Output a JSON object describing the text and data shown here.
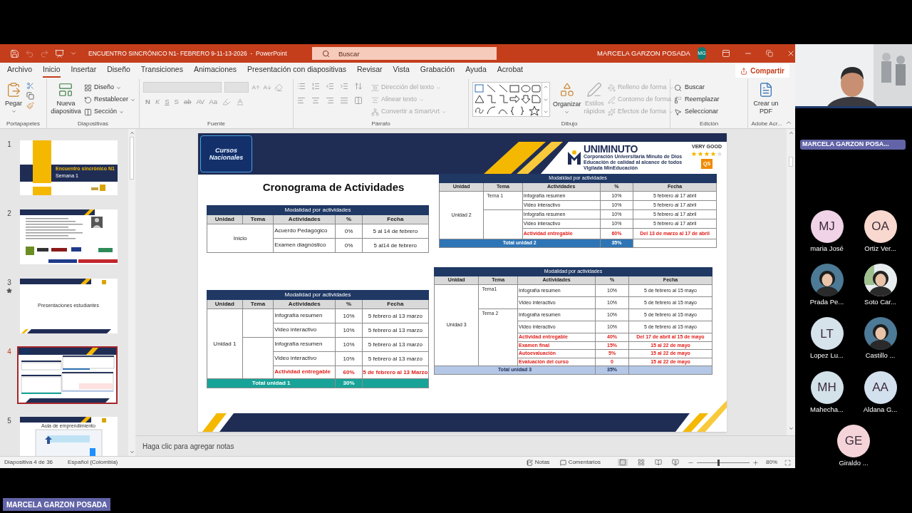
{
  "title_bar": {
    "title": "ENCUENTRO SINCRÓNICO N1- FEBRERO 9-11-13-2026  -  PowerPoint",
    "search": {
      "placeholder": "Buscar"
    },
    "user": "MARCELA GARZON POSADA",
    "avatar": "MG"
  },
  "tabs": [
    {
      "label": "Archivo",
      "selected": false
    },
    {
      "label": "Inicio",
      "selected": true
    },
    {
      "label": "Insertar",
      "selected": false
    },
    {
      "label": "Diseño",
      "selected": false
    },
    {
      "label": "Transiciones",
      "selected": false
    },
    {
      "label": "Animaciones",
      "selected": false
    },
    {
      "label": "Presentación con diapositivas",
      "selected": false
    },
    {
      "label": "Revisar",
      "selected": false
    },
    {
      "label": "Vista",
      "selected": false
    },
    {
      "label": "Grabación",
      "selected": false
    },
    {
      "label": "Ayuda",
      "selected": false
    },
    {
      "label": "Acrobat",
      "selected": false
    }
  ],
  "share_button": "Compartir",
  "ribbon": {
    "clipboard": {
      "label": "Portapapeles",
      "paste": "Pegar"
    },
    "slides": {
      "label": "Diapositivas",
      "new_slide": "Nueva diapositiva",
      "commands": [
        "Diseño",
        "Restablecer",
        "Sección"
      ]
    },
    "font": {
      "label": "Fuente",
      "disabled": true,
      "format_buttons": [
        "N",
        "K",
        "S",
        "S",
        "ab",
        "AV",
        "Aa"
      ]
    },
    "paragraph": {
      "label": "Párrafo",
      "commands": [
        {
          "label": "Dirección del texto",
          "disabled": true
        },
        {
          "label": "Alinear texto",
          "disabled": true
        },
        {
          "label": "Convertir a SmartArt",
          "disabled": true
        }
      ]
    },
    "drawing": {
      "label": "Dibujo",
      "arrange": "Organizar",
      "quick_styles": {
        "label": "Estilos rápidos",
        "disabled": true
      },
      "commands": [
        {
          "label": "Relleno de forma",
          "disabled": true
        },
        {
          "label": "Contorno de forma",
          "disabled": true
        },
        {
          "label": "Efectos de forma",
          "disabled": true
        }
      ]
    },
    "editing": {
      "label": "Edición",
      "commands": [
        "Buscar",
        "Reemplazar",
        "Seleccionar"
      ]
    },
    "adobe": {
      "label": "Adobe Acr...",
      "create_pdf": "Crear un PDF"
    }
  },
  "thumbnails": [
    {
      "number": "1",
      "kind": "title",
      "selected": false,
      "starred": false,
      "texts": [
        "Encuentro sincrónico N1",
        "Semana 1"
      ]
    },
    {
      "number": "2",
      "kind": "content",
      "selected": false,
      "starred": false
    },
    {
      "number": "3",
      "kind": "section",
      "selected": false,
      "starred": true,
      "texts": [
        "Presentaciones estudiantes"
      ]
    },
    {
      "number": "4",
      "kind": "tables",
      "selected": true,
      "starred": false
    },
    {
      "number": "5",
      "kind": "screenshot",
      "selected": false,
      "starred": false,
      "texts": [
        "Aula de emprendimiento"
      ]
    }
  ],
  "slide": {
    "title": "Cronograma de Actividades",
    "logo_left": "Cursos Nacionales",
    "logo_right": {
      "name": "UNIMINUTO",
      "lines": [
        "Corporación Universitaria Minuto de Dios",
        "Educación de calidad al alcance de todos",
        "Vigilada MinEducación"
      ],
      "rating": "VERY GOOD",
      "stars": 4,
      "badge": "QS"
    },
    "tables": [
      {
        "header": "Modalidad por actividades",
        "columns": [
          "Unidad",
          "Tema",
          "Actividades",
          "%",
          "Fecha"
        ],
        "unit": "Inicio",
        "rows": [
          {
            "activity": "Acuerdo Pedagógico",
            "percent": "0%",
            "date": "5 al 14 de febrero",
            "emphasis": false
          },
          {
            "activity": "Examen diagnóstico",
            "percent": "0%",
            "date": "5 al14 de febrero",
            "emphasis": false
          }
        ]
      },
      {
        "header": "Modalidad por actividades",
        "columns": [
          "Unidad",
          "Tema",
          "Actividades",
          "%",
          "Fecha"
        ],
        "unit": "Unidad 2",
        "temas": [
          {
            "label": "Tema 1",
            "rows": [
              {
                "activity": "Infografía resumen",
                "percent": "10%",
                "date": "5 febrero al 17 abril",
                "emphasis": false
              },
              {
                "activity": "Video interactivo",
                "percent": "10%",
                "date": "5 febrero al 17 abril",
                "emphasis": false
              }
            ]
          },
          {
            "rows": [
              {
                "activity": "Infografía resumen",
                "percent": "10%",
                "date": "5 febrero al 17 abril",
                "emphasis": false
              },
              {
                "activity": "Video interactivo",
                "percent": "10%",
                "date": "5 febrero al 17 abril",
                "emphasis": false
              },
              {
                "activity": "Actividad entregable",
                "percent": "60%",
                "date": "Del 13 de marzo al 17 de abril",
                "emphasis": true
              }
            ]
          }
        ],
        "total": {
          "label": "Total unidad 2",
          "percent": "35%",
          "color": "#2e75b6",
          "spans_date": false
        }
      },
      {
        "header": "Modalidad por actividades",
        "columns": [
          "Unidad",
          "Tema",
          "Actividades",
          "%",
          "Fecha"
        ],
        "unit": "Unidad 1",
        "temas": [
          {
            "rows": [
              {
                "activity": "Infografía resumen",
                "percent": "10%",
                "date": "5 febrero al 13 marzo",
                "emphasis": false
              },
              {
                "activity": "Video interactivo",
                "percent": "10%",
                "date": "5 febrero al 13 marzo",
                "emphasis": false
              }
            ]
          },
          {
            "rows": [
              {
                "activity": "Infografía resumen",
                "percent": "10%",
                "date": "5 febrero al 13 marzo",
                "emphasis": false
              },
              {
                "activity": "Video interactivo",
                "percent": "10%",
                "date": "5 febrero al 13 marzo",
                "emphasis": false
              },
              {
                "activity": "Actividad entregable",
                "percent": "60%",
                "date": "5 de febrero al 13 Marzo",
                "emphasis": true
              }
            ]
          }
        ],
        "total": {
          "label": "Total unidad 1",
          "percent": "30%",
          "color": "#17a398",
          "spans_date": true
        }
      },
      {
        "header": "Modalidad por actividades",
        "columns": [
          "Unidad",
          "Tema",
          "Actividades",
          "%",
          "Fecha"
        ],
        "unit": "Unidad 3",
        "temas": [
          {
            "label": "Tema1",
            "rows": [
              {
                "activity": "Infografía resumen",
                "percent": "10%",
                "date": "5 de febrero al 15 mayo",
                "emphasis": false
              },
              {
                "activity": "Video interactivo",
                "percent": "10%",
                "date": "5 de febrero al 15 mayo",
                "emphasis": false
              }
            ]
          },
          {
            "label": "Tema 2",
            "rows": [
              {
                "activity": "Infografía resumen",
                "percent": "10%",
                "date": "5 de febrero al 15 mayo",
                "emphasis": false
              },
              {
                "activity": "Video interactivo",
                "percent": "10%",
                "date": "5 de febrero al 15 mayo",
                "emphasis": false
              },
              {
                "activity": "Actividad entregable",
                "percent": "40%",
                "date": "Del 17 de abril al 15 de mayo",
                "emphasis": true
              },
              {
                "activity": "Examen final",
                "percent": "15%",
                "date": "15 al 22 de mayo",
                "emphasis": true
              },
              {
                "activity": "Autoevaluación",
                "percent": "5%",
                "date": "15 al 22 de mayo",
                "emphasis": true
              },
              {
                "activity": "Evaluación del curso",
                "percent": "0",
                "date": "15 al 22 de mayo",
                "emphasis": true
              }
            ]
          }
        ],
        "total": {
          "label": "Total unidad 3",
          "percent": "35%",
          "color": "#b4c7e7",
          "spans_date": true
        }
      }
    ]
  },
  "notes": {
    "placeholder": "Haga clic para agregar notas"
  },
  "status_bar": {
    "slide_info": "Diapositiva 4 de 36",
    "language": "Español (Colombia)",
    "notes": "Notas",
    "comments": "Comentarios",
    "zoom": {
      "level": 0.4,
      "reading": "80%"
    }
  },
  "meeting": {
    "presenter_label": "MARCELA GARZON POSA...",
    "participants": [
      {
        "kind": "initials",
        "initials": "MJ",
        "name": "maria José",
        "color": "#f0d3e6"
      },
      {
        "kind": "initials",
        "initials": "OA",
        "name": "Ortiz Ver...",
        "color": "#f8d8cf"
      },
      {
        "kind": "picture",
        "name": "Prada Pe..."
      },
      {
        "kind": "picture",
        "name": "Soto Car..."
      },
      {
        "kind": "initials",
        "initials": "LT",
        "name": "Lopez Lu...",
        "color": "#d7e3ea"
      },
      {
        "kind": "picture",
        "name": "Castillo ..."
      },
      {
        "kind": "initials",
        "initials": "MH",
        "name": "Mahecha...",
        "color": "#d3e1e9"
      },
      {
        "kind": "initials",
        "initials": "AA",
        "name": "Aldana G...",
        "color": "#d3e1ef"
      },
      {
        "kind": "initials",
        "initials": "GE",
        "name": "Giraldo ...",
        "color": "#f4d4d9"
      }
    ],
    "screen_share_label": "MARCELA GARZON POSADA"
  }
}
